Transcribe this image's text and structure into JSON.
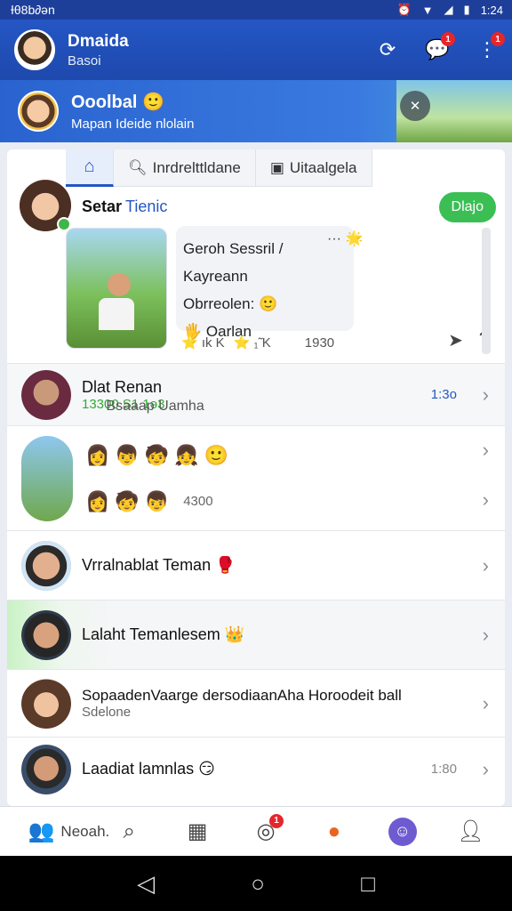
{
  "statusbar": {
    "left_text": "Ɨθ8b∂ən",
    "time": "1:24"
  },
  "appbar": {
    "title": "Dmaida",
    "subtitle": "Basoi",
    "badge_count": "1",
    "menu_badge": "1"
  },
  "banner": {
    "title": "Ooolbal 🙂",
    "subtitle": "Mapan Ideide nlolain"
  },
  "tabs": {
    "search_label": "Inrdrelttldane",
    "files_label": "Uitaalgela"
  },
  "post": {
    "name": "Setar",
    "tag": "Tienic",
    "join_label": "Dlajo",
    "lines": [
      "Geroh Sessril  /",
      "Kayreann",
      "Obrreolen: 🙂",
      "🖐 Oarlan"
    ],
    "more": "···",
    "reaction_1": "⭐ ık K",
    "reaction_2": "⭐ ₁̃ K",
    "reaction_count": "1930"
  },
  "list": [
    {
      "name": "Dlat Renan",
      "sub": "13300 S1 1ə3",
      "extra": "Bsaaap Uamha",
      "time": "1:3o"
    },
    {
      "name": "",
      "count": "4300"
    },
    {
      "name": "Vrralnablat Teman 🥊"
    },
    {
      "name": "Lalaht Temanlesem 👑"
    },
    {
      "name": "SopaadenVaarge dersodiaanAha Horoodeit ball",
      "sub": "Sdelone"
    },
    {
      "name": "Laadiat lamnlas 😏",
      "time": "1:80"
    }
  ],
  "bottomnav": {
    "first_label": "Neoah.",
    "notif_badge": "1"
  }
}
